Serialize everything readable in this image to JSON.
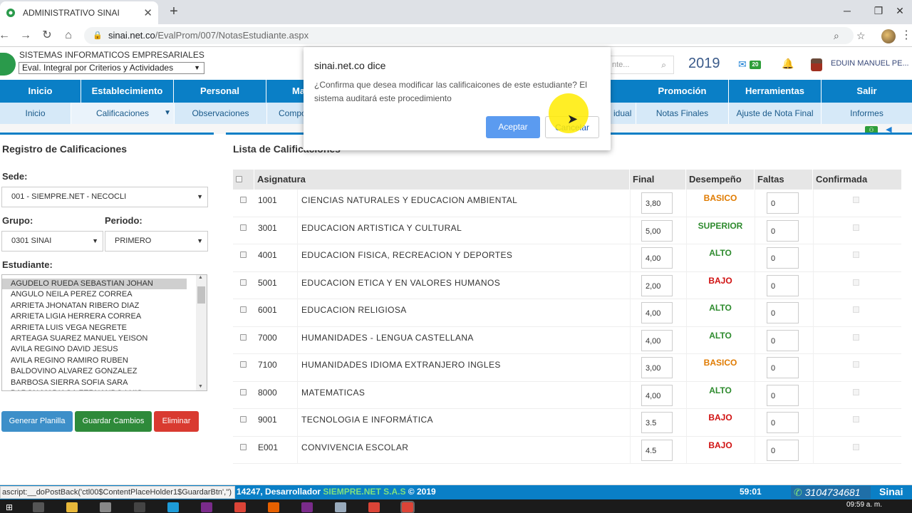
{
  "browser": {
    "tab_title": "ADMINISTRATIVO SINAI",
    "url_domain": "sinai.net.co",
    "url_path": "/EvalProm/007/NotasEstudiante.aspx"
  },
  "header": {
    "site_name": "SISTEMAS INFORMATICOS EMPRESARIALES",
    "eval_select": "Eval. Integral por Criterios y Actividades",
    "search_placeholder": "nte...",
    "year": "2019",
    "mail_count": "20",
    "user": "EDUIN MANUEL PE..."
  },
  "main_nav": [
    "Inicio",
    "Establecimiento",
    "Personal",
    "Ma",
    "",
    "",
    "",
    "Promoción",
    "Herramientas",
    "Salir"
  ],
  "sub_nav": [
    "Inicio",
    "Calificaciones",
    "Observaciones",
    "Compo",
    "",
    "",
    "idual",
    "Notas Finales",
    "Ajuste de Nota Final",
    "Informes"
  ],
  "left": {
    "title": "Registro de Calificaciones",
    "sede_label": "Sede:",
    "sede_value": "001 - SIEMPRE.NET - NECOCLI",
    "grupo_label": "Grupo:",
    "grupo_value": "0301 SINAI",
    "periodo_label": "Periodo:",
    "periodo_value": "PRIMERO",
    "estudiante_label": "Estudiante:",
    "students": [
      "AGUDELO RUEDA SEBASTIAN JOHAN",
      "ANGULO NEILA PEREZ CORREA",
      "ARRIETA JHONATAN RIBERO DIAZ",
      "ARRIETA LIGIA HERRERA CORREA",
      "ARRIETA LUIS VEGA NEGRETE",
      "ARTEAGA SUAREZ MANUEL YEISON",
      "AVILA REGINO DAVID JESUS",
      "AVILA REGINO RAMIRO RUBEN",
      "BALDOVINO ALVAREZ GONZALEZ",
      "BARBOSA SIERRA SOFIA SARA",
      "BARON MADIAGA FERNANDO LUIS"
    ],
    "btn_generar": "Generar Planilla",
    "btn_guardar": "Guardar Cambios",
    "btn_eliminar": "Eliminar"
  },
  "right": {
    "title": "Lista de Calificaciones",
    "columns": [
      "Asignatura",
      "Final",
      "Desempeño",
      "Faltas",
      "Confirmada"
    ],
    "rows": [
      {
        "code": "1001",
        "name": "CIENCIAS NATURALES Y EDUCACION AMBIENTAL",
        "final": "3,80",
        "desempeno": "BASICO",
        "faltas": "0"
      },
      {
        "code": "3001",
        "name": "EDUCACION ARTISTICA Y CULTURAL",
        "final": "5,00",
        "desempeno": "SUPERIOR",
        "faltas": "0"
      },
      {
        "code": "4001",
        "name": "EDUCACION FISICA, RECREACION Y DEPORTES",
        "final": "4,00",
        "desempeno": "ALTO",
        "faltas": "0"
      },
      {
        "code": "5001",
        "name": "EDUCACION ETICA Y EN VALORES HUMANOS",
        "final": "2,00",
        "desempeno": "BAJO",
        "faltas": "0"
      },
      {
        "code": "6001",
        "name": "EDUCACION RELIGIOSA",
        "final": "4,00",
        "desempeno": "ALTO",
        "faltas": "0"
      },
      {
        "code": "7000",
        "name": "HUMANIDADES - LENGUA CASTELLANA",
        "final": "4,00",
        "desempeno": "ALTO",
        "faltas": "0"
      },
      {
        "code": "7100",
        "name": "HUMANIDADES IDIOMA EXTRANJERO INGLES",
        "final": "3,00",
        "desempeno": "BASICO",
        "faltas": "0"
      },
      {
        "code": "8000",
        "name": "MATEMATICAS",
        "final": "4,00",
        "desempeno": "ALTO",
        "faltas": "0"
      },
      {
        "code": "9001",
        "name": "TECNOLOGIA E INFORMÁTICA",
        "final": "3.5",
        "desempeno": "BAJO",
        "faltas": "0"
      },
      {
        "code": "E001",
        "name": "CONVIVENCIA ESCOLAR",
        "final": "4.5",
        "desempeno": "BAJO",
        "faltas": "0"
      }
    ]
  },
  "desempeno_colors": {
    "BASICO": "#e07b00",
    "SUPERIOR": "#2e8b2e",
    "ALTO": "#2e8b2e",
    "BAJO": "#d01010"
  },
  "dialog": {
    "title": "sinai.net.co dice",
    "message": "¿Confirma que desea modificar las calificaicones de este estudiante? El sistema auditará este procedimiento",
    "ok": "Aceptar",
    "cancel": "Cancelar"
  },
  "footer": {
    "left_text": "14247, Desarrollador",
    "brand": "SIEMPRE.NET S.A.S",
    "copyright": "© 2019",
    "timer": "59:01",
    "phone": "3104734681",
    "sinai": "Sinai"
  },
  "status_bar": "ascript:__doPostBack('ctl00$ContentPlaceHolder1$GuardarBtn','')",
  "clock": "09:59 a. m."
}
